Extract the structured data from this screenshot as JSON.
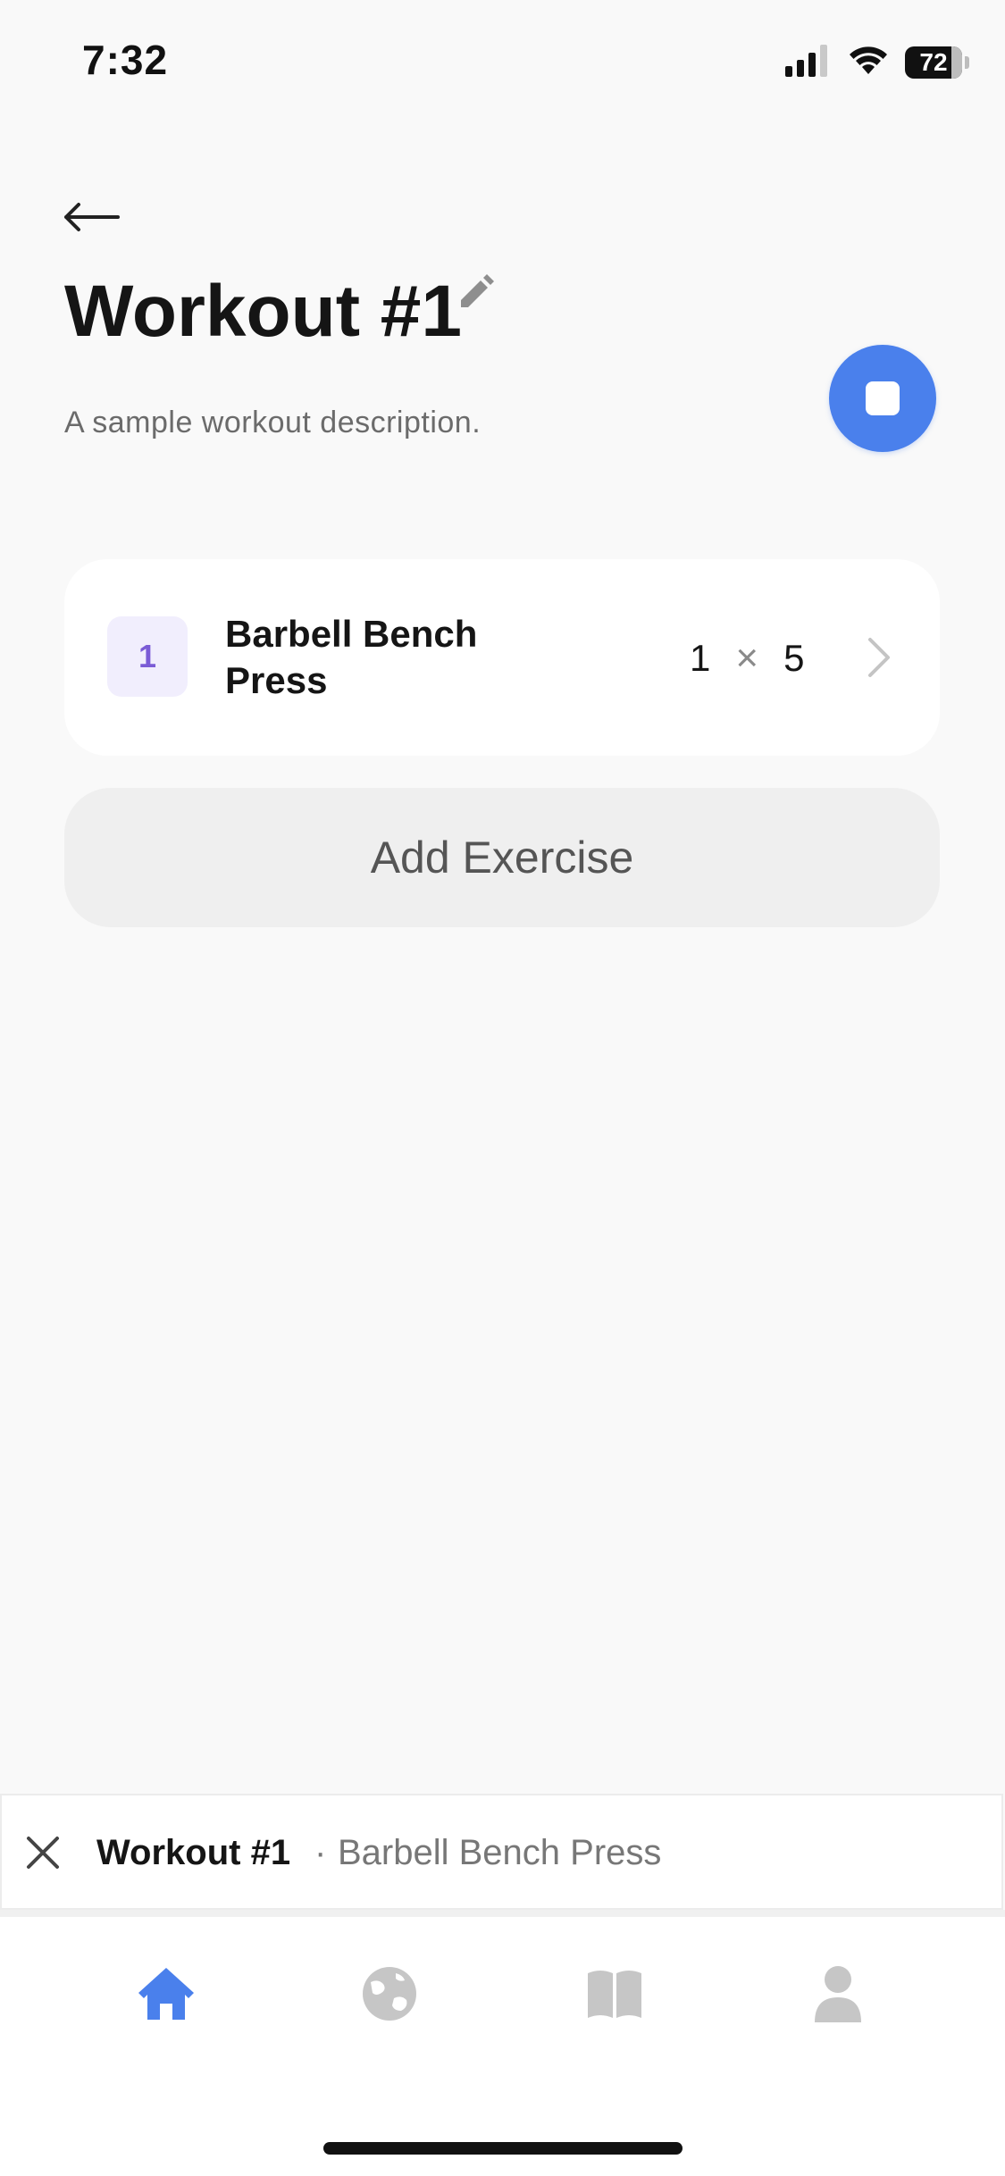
{
  "status_bar": {
    "time": "7:32",
    "battery": "72",
    "battery_level": 0.72,
    "icons": [
      "signal-icon",
      "wifi-icon",
      "battery-icon"
    ]
  },
  "header": {
    "back_icon": "arrow-left-icon",
    "title": "Workout #1",
    "edit_icon": "pencil-icon",
    "description": "A sample workout description.",
    "stop_icon": "stop-icon"
  },
  "exercises": [
    {
      "index": "1",
      "name": "Barbell Bench Press",
      "sets": "1",
      "times_symbol": "×",
      "reps": "5",
      "chevron_icon": "chevron-right-icon"
    }
  ],
  "add_exercise_label": "Add Exercise",
  "active_workout": {
    "close_icon": "close-icon",
    "title": "Workout #1",
    "separator": "·",
    "current_exercise": "Barbell Bench Press"
  },
  "tabs": [
    {
      "icon": "home-icon",
      "active": true
    },
    {
      "icon": "globe-icon",
      "active": false
    },
    {
      "icon": "book-icon",
      "active": false
    },
    {
      "icon": "person-icon",
      "active": false
    }
  ],
  "colors": {
    "accent": "#4a80ec",
    "background": "#f9f9f9",
    "index_badge_bg": "#f1eefd",
    "index_badge_text": "#7b5cd6",
    "tab_inactive": "#c6c6c6"
  }
}
